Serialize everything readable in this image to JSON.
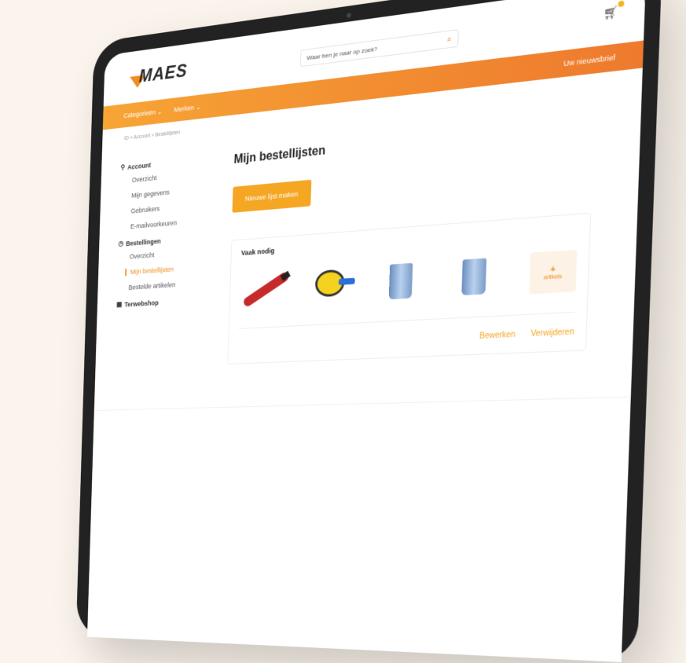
{
  "header": {
    "logo_text": "MAES",
    "logo_sub": "",
    "search_placeholder": "Waar ben je naar op zoek?",
    "accent": "#f28c1e"
  },
  "nav": {
    "items": [
      "Categorieën ⌄",
      "Merken ⌄"
    ],
    "right": "Uw nieuwsbrief"
  },
  "breadcrumb": "ID > Account > Bestellijsten",
  "sidebar": {
    "account": {
      "title": "Account",
      "items": [
        "Overzicht",
        "Mijn gegevens",
        "Gebruikers",
        "E-mailvoorkeuren"
      ]
    },
    "orders": {
      "title": "Bestellingen",
      "items": [
        "Overzicht",
        "Mijn bestellijsten",
        "Bestelde artikelen"
      ]
    },
    "webshop": "Terwebshop"
  },
  "main": {
    "title": "Mijn bestellijsten",
    "new_button": "Nieuwe lijst maken",
    "card": {
      "title": "Vaak nodig",
      "products": [
        "cutter",
        "tape-measure",
        "cup",
        "cup"
      ],
      "more_count": "+",
      "more_label": "artikels",
      "actions": [
        "Bewerken",
        "Verwijderen"
      ]
    }
  }
}
